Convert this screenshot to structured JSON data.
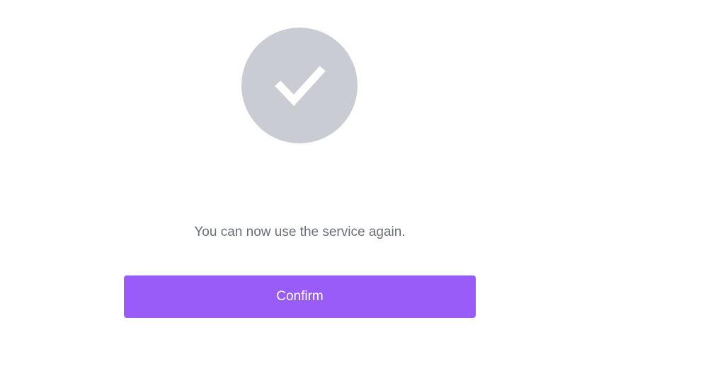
{
  "status": {
    "icon": "checkmark-icon",
    "circle_color": "#c9ccd3",
    "check_color": "#ffffff"
  },
  "message": "You can now use the service again.",
  "message_color": "#6b6f7a",
  "confirm_button": {
    "label": "Confirm",
    "color": "#9a5cf9"
  }
}
